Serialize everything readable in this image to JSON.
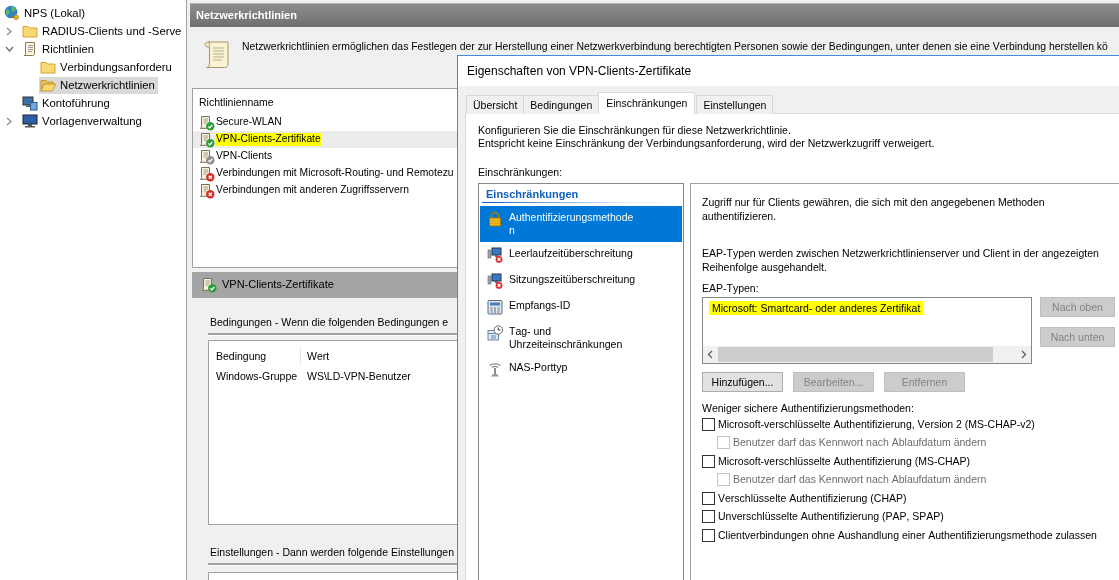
{
  "tree": [
    {
      "label": "NPS (Lokal)",
      "kind": "server",
      "selected": false,
      "children": [
        {
          "label": "RADIUS-Clients und -Serve",
          "kind": "folder",
          "expanded": false,
          "selected": false
        },
        {
          "label": "Richtlinien",
          "kind": "policies",
          "expanded": true,
          "selected": false,
          "children": [
            {
              "label": "Verbindungsanforderu",
              "kind": "folder",
              "selected": false
            },
            {
              "label": "Netzwerkrichtlinien",
              "kind": "folder",
              "selected": true
            }
          ]
        },
        {
          "label": "Kontoführung",
          "kind": "accounting",
          "selected": false
        },
        {
          "label": "Vorlagenverwaltung",
          "kind": "templates",
          "expanded": false,
          "selected": false
        }
      ]
    }
  ],
  "pane": {
    "title": "Netzwerkrichtlinien",
    "description": "Netzwerkrichtlinien ermöglichen das Festlegen der zur Herstellung einer Netzwerkverbindung berechtigten Personen sowie der Bedingungen, unter denen sie eine Verbindung herstellen kö",
    "policies": {
      "column": "Richtlinienname",
      "rows": [
        {
          "name": "Secure-WLAN",
          "kind": "grant",
          "selected": false,
          "highlighted": false
        },
        {
          "name": "VPN-Clients-Zertifikate",
          "kind": "grant",
          "selected": true,
          "highlighted": true
        },
        {
          "name": "VPN-Clients",
          "kind": "disabled",
          "selected": false,
          "highlighted": false
        },
        {
          "name": "Verbindungen mit Microsoft-Routing- und Remotezu",
          "kind": "deny",
          "selected": false,
          "highlighted": false
        },
        {
          "name": "Verbindungen mit anderen Zugriffsservern",
          "kind": "deny",
          "selected": false,
          "highlighted": false
        }
      ]
    },
    "details": {
      "title": "VPN-Clients-Zertifikate",
      "kind": "grant",
      "conditions_heading": "Bedingungen - Wenn die folgenden Bedingungen e",
      "conditions": {
        "columns": [
          "Bedingung",
          "Wert"
        ],
        "rows": [
          [
            "Windows-Gruppe",
            "WS\\LD-VPN-Benutzer"
          ]
        ]
      },
      "settings_heading": "Einstellungen - Dann werden folgende Einstellungen"
    }
  },
  "dialog": {
    "title": "Eigenschaften von VPN-Clients-Zertifikate",
    "tabs": [
      {
        "label": "Übersicht",
        "selected": false
      },
      {
        "label": "Bedingungen",
        "selected": false
      },
      {
        "label": "Einschränkungen",
        "selected": true
      },
      {
        "label": "Einstellungen",
        "selected": false
      }
    ],
    "intro": [
      "Konfigurieren Sie die Einschränkungen für diese Netzwerkrichtlinie.",
      "Entspricht keine Einschränkung der Verbindungsanforderung, wird der Netzwerkzugriff verweigert."
    ],
    "constraints_label": "Einschränkungen:",
    "constraints": {
      "heading": "Einschränkungen",
      "items": [
        {
          "label": "Authentifizierungsmethoden",
          "kind": "auth",
          "selected": true
        },
        {
          "label": "Leerlaufzeitüberschreitung",
          "kind": "idle",
          "selected": false
        },
        {
          "label": "Sitzungszeitüberschreitung",
          "kind": "session",
          "selected": false
        },
        {
          "label": "Empfangs-ID",
          "kind": "called-id",
          "selected": false
        },
        {
          "label": "Tag- und Uhrzeiteinschränkungen",
          "kind": "time",
          "selected": false
        },
        {
          "label": "NAS-Porttyp",
          "kind": "port",
          "selected": false
        }
      ]
    },
    "auth": {
      "intro": "Zugriff nur für Clients gewähren, die sich mit den angegebenen Methoden authentifizieren.",
      "eap_note": "EAP-Typen werden zwischen Netzwerkrichtlinienserver und Client in der angezeigten Reihenfolge ausgehandelt.",
      "eap_label": "EAP-Typen:",
      "eap_types": [
        {
          "label": "Microsoft: Smartcard- oder anderes Zertifikat",
          "highlighted": true
        }
      ],
      "order_buttons": [
        {
          "label": "Nach oben",
          "disabled": true
        },
        {
          "label": "Nach unten",
          "disabled": true
        }
      ],
      "buttons": [
        {
          "label": "Hinzufügen...",
          "disabled": false
        },
        {
          "label": "Bearbeiten...",
          "disabled": true
        },
        {
          "label": "Entfernen",
          "disabled": true
        }
      ],
      "legacy_label": "Weniger sichere Authentifizierungsmethoden:",
      "legacy_methods": [
        {
          "label": "Microsoft-verschlüsselte Authentifizierung, Version 2 (MS-CHAP-v2)",
          "checked": false,
          "disabled": false,
          "children": [
            {
              "label": "Benutzer darf das Kennwort nach Ablaufdatum ändern",
              "checked": false,
              "disabled": true
            }
          ]
        },
        {
          "label": "Microsoft-verschlüsselte Authentifizierung (MS-CHAP)",
          "checked": false,
          "disabled": false,
          "children": [
            {
              "label": "Benutzer darf das Kennwort nach Ablaufdatum ändern",
              "checked": false,
              "disabled": true
            }
          ]
        },
        {
          "label": "Verschlüsselte Authentifizierung (CHAP)",
          "checked": false,
          "disabled": false
        },
        {
          "label": "Unverschlüsselte Authentifizierung (PAP, SPAP)",
          "checked": false,
          "disabled": false
        },
        {
          "label": "Clientverbindungen ohne Aushandlung einer Authentifizierungsmethode zulassen",
          "checked": false,
          "disabled": false
        }
      ]
    }
  }
}
